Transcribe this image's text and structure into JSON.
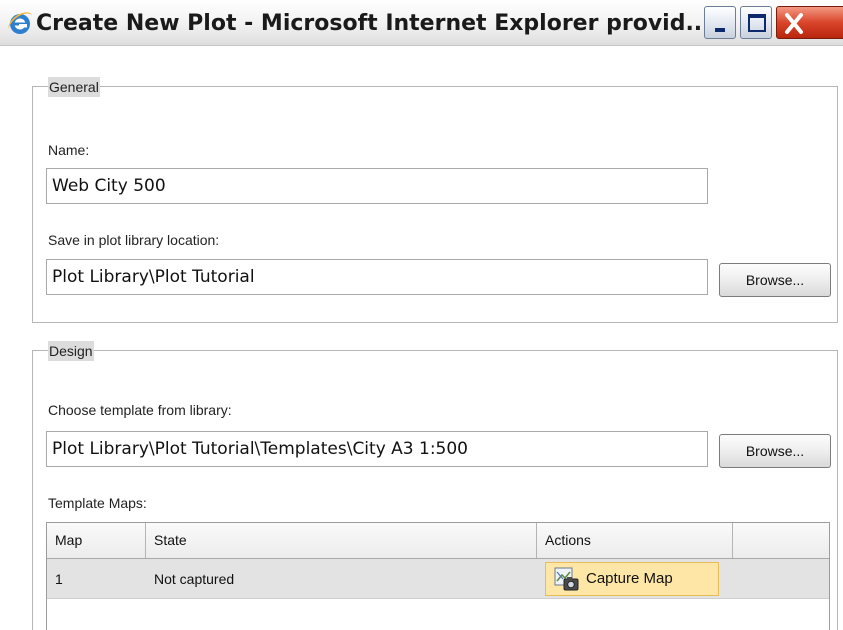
{
  "window": {
    "title": "Create New Plot - Microsoft Internet Explorer provid...",
    "controls": {
      "minimize": "minimize-icon",
      "maximize": "maximize-icon",
      "close": "close-icon"
    }
  },
  "general": {
    "legend": "General",
    "name_label": "Name:",
    "name_value": "Web City 500",
    "location_label": "Save in plot library location:",
    "location_value": "Plot Library\\Plot Tutorial",
    "browse_label": "Browse..."
  },
  "design": {
    "legend": "Design",
    "template_label": "Choose template from library:",
    "template_value": "Plot Library\\Plot Tutorial\\Templates\\City A3 1:500",
    "browse_label": "Browse...",
    "maps_label": "Template Maps:",
    "table": {
      "columns": [
        "Map",
        "State",
        "Actions",
        ""
      ],
      "rows": [
        {
          "map": "1",
          "state": "Not captured",
          "action_label": "Capture Map",
          "action_icon": "capture-map-icon"
        }
      ]
    }
  },
  "colors": {
    "row_highlight": "#e3e3e3",
    "capture_button": "#fde6a6",
    "close_button": "#d9452a",
    "legend_bg": "#dcdcdc"
  }
}
